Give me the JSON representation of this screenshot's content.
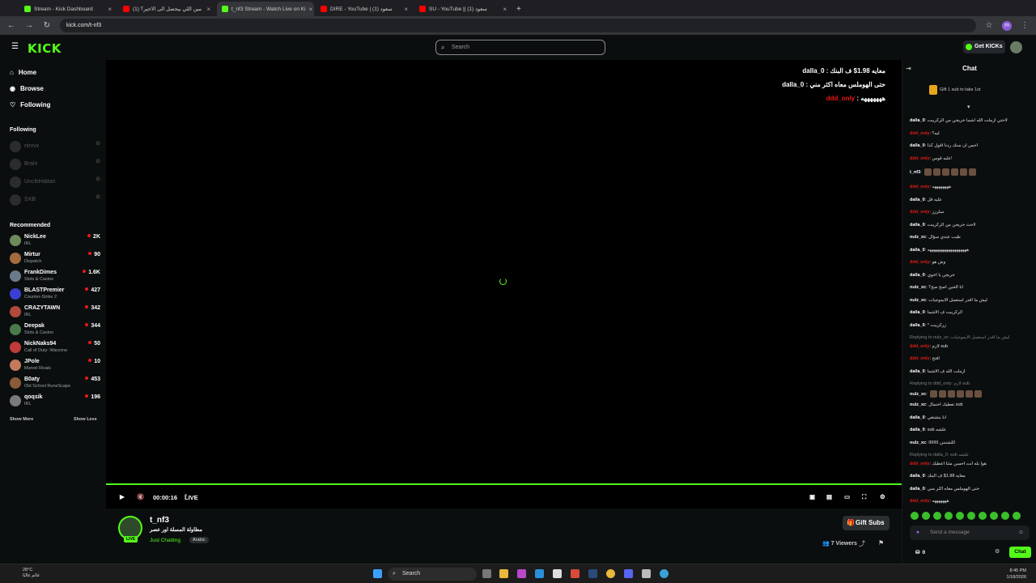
{
  "browser": {
    "tabs": [
      {
        "label": "Stream - Kick Dashboard",
        "color": "#53fc18"
      },
      {
        "label": "(1) مين اللي بيحصل الى الاخير؟",
        "color": "#ff0000"
      },
      {
        "label": "t_nf3 Stream - Watch Live on Ki",
        "color": "#53fc18"
      },
      {
        "label": "DIRE - YouTube | (1) سعود",
        "color": "#ff0000"
      },
      {
        "label": "SU - YouTube || سعود (1)",
        "color": "#ff0000"
      }
    ],
    "url": "kick.com/t-nf3"
  },
  "header": {
    "logo": "KICK",
    "search_placeholder": "Search",
    "get_kicks": "Get KICKs"
  },
  "sidebar": {
    "nav": [
      "Home",
      "Browse",
      "Following"
    ],
    "following_title": "Following",
    "following": [
      "nirvvx",
      "Brain",
      "UncleHattan",
      "SXB"
    ],
    "recommended_title": "Recommended",
    "recommended": [
      {
        "name": "NickLee",
        "category": "IRL",
        "viewers": "2K",
        "color": "#6d8b5a"
      },
      {
        "name": "Mirtur",
        "category": "Dispatch",
        "viewers": "90",
        "color": "#a46b3d"
      },
      {
        "name": "FrankDimes",
        "category": "Slots & Casino",
        "viewers": "1.6K",
        "color": "#6a7a8a"
      },
      {
        "name": "BLASTPremier",
        "category": "Counter-Strike 2",
        "viewers": "427",
        "color": "#3b3fd1"
      },
      {
        "name": "CRAZYTAWN",
        "category": "IRL",
        "viewers": "342",
        "color": "#b04a3a"
      },
      {
        "name": "Deepak",
        "category": "Slots & Casino",
        "viewers": "344",
        "color": "#4a7a4a"
      },
      {
        "name": "NickNaks94",
        "category": "Call of Duty: Warzone",
        "viewers": "50",
        "color": "#c23a3a"
      },
      {
        "name": "JPole",
        "category": "Marvel Rivals",
        "viewers": "10",
        "color": "#c27a5a"
      },
      {
        "name": "B0aty",
        "category": "Old School RuneScape",
        "viewers": "453",
        "color": "#8a5a3a"
      },
      {
        "name": "qoqsik",
        "category": "IRL",
        "viewers": "196",
        "color": "#7a7a7a"
      }
    ],
    "show_more": "Show More",
    "show_less": "Show Less"
  },
  "player": {
    "overlay": [
      {
        "user": "dalla_0",
        "text": "معايه 1.98$ ف البنك",
        "color": "#ffffff"
      },
      {
        "user": "dalla_0",
        "text": "حتى الهوملس معاه اكثر مني",
        "color": "#ffffff"
      },
      {
        "user": "ddd_only",
        "text": "هههههههه",
        "color": "#e91916"
      }
    ],
    "time": "00:00:16",
    "live_label": "LIVE"
  },
  "stream": {
    "name": "t_nf3",
    "title": "مطاولة المسلة اور عصر",
    "category": "Just Chatting",
    "language": "Arabic",
    "gift_subs": "Gift Subs",
    "viewers": "7 Viewers",
    "live_badge": "LIVE"
  },
  "chat": {
    "title": "Chat",
    "gift_banner": "Gift 1 sub to take 1st",
    "messages": [
      {
        "user": "dalla_0",
        "text": "لاحتي ازملت الله اشما خريجي من الركريبت",
        "color": "#ffffff",
        "reply": false
      },
      {
        "user": "ddd_only",
        "text": "ليه؟",
        "color": "#e91916",
        "reply": false
      },
      {
        "user": "dalla_0",
        "text": "احس ان سنك ردنا اقول كذا",
        "color": "#ffffff",
        "reply": false
      },
      {
        "user": "ddd_only",
        "text": "عليه قوس!",
        "color": "#e91916",
        "reply": false
      },
      {
        "user": "t_nf3",
        "text": "",
        "color": "#ffffff",
        "reply": false
      },
      {
        "user": "ddd_only",
        "text": "ههههههههه",
        "color": "#e91916",
        "reply": false
      },
      {
        "user": "dalla_0",
        "text": "عليه قل",
        "color": "#ffffff",
        "reply": false
      },
      {
        "user": "ddd_only",
        "text": "سلرزز",
        "color": "#e91916",
        "reply": false
      },
      {
        "user": "dalla_0",
        "text": "لاحث خريجن من الركريبت",
        "color": "#ffffff",
        "reply": false
      },
      {
        "user": "nulz_xc",
        "text": "طيب عندي سؤال",
        "color": "#ffffff",
        "reply": false
      },
      {
        "user": "dalla_0",
        "text": "هههههههههههههههههههه",
        "color": "#ffffff",
        "reply": false
      },
      {
        "user": "ddd_only",
        "text": "وش هو",
        "color": "#e91916",
        "reply": false
      },
      {
        "user": "dalla_0",
        "text": "خريجن يا اخوي",
        "color": "#ffffff",
        "reply": false
      },
      {
        "user": "nulz_xc",
        "text": "انا الحين اصح صح؟",
        "color": "#ffffff",
        "reply": false
      },
      {
        "user": "nulz_xc",
        "text": "ليش ما اقدر استعمل الايموجيات",
        "color": "#ffffff",
        "reply": false
      },
      {
        "user": "dalla_0",
        "text": "الركريبت ف الاشما",
        "color": "#ffffff",
        "reply": false
      },
      {
        "user": "dalla_0",
        "text": "* زركريبت",
        "color": "#ffffff",
        "reply": false
      },
      {
        "user": "",
        "text": "Replying to nulz_xc: ليش ما اقدر استعمل الايموجيات",
        "color": "#7c8286",
        "reply": true
      },
      {
        "user": "ddd_only",
        "text": "لازم sub",
        "color": "#e91916",
        "reply": false
      },
      {
        "user": "ddd_only",
        "text": "افتح",
        "color": "#e91916",
        "reply": false
      },
      {
        "user": "dalla_0",
        "text": "ازملت الله ف الاشما",
        "color": "#ffffff",
        "reply": false
      },
      {
        "user": "",
        "text": "Replying to ddd_only: لازم sub",
        "color": "#7c8286",
        "reply": true
      },
      {
        "user": "nulz_xc",
        "text": "",
        "color": "#ffffff",
        "reply": false
      },
      {
        "user": "nulz_xc",
        "text": "تعطيك احتمال sub",
        "color": "#ffffff",
        "reply": false
      },
      {
        "user": "dalla_0",
        "text": "انا بتشتغي",
        "color": "#ffffff",
        "reply": false
      },
      {
        "user": "dalla_0",
        "text": "sub علشه",
        "color": "#ffffff",
        "reply": false
      },
      {
        "user": "nulz_xc",
        "text": "IIIIIIII اللشنننن",
        "color": "#ffffff",
        "reply": false
      },
      {
        "user": "",
        "text": "Replying to dalla_0: sub علشه",
        "color": "#7c8286",
        "reply": true
      },
      {
        "user": "ddd_only",
        "text": "هوا بله انت احسن مثنا اعطيك",
        "color": "#e91916",
        "reply": false
      },
      {
        "user": "dalla_0",
        "text": "معايه 1.98$ ف البنك",
        "color": "#ffffff",
        "reply": false
      },
      {
        "user": "dalla_0",
        "text": "حتى الهوملس معاه اكثر مني",
        "color": "#ffffff",
        "reply": false
      },
      {
        "user": "ddd_only",
        "text": "هههههههه",
        "color": "#e91916",
        "reply": false
      }
    ],
    "input_placeholder": "Send a message",
    "send_label": "Chat",
    "points": "0"
  },
  "taskbar": {
    "search": "Search",
    "weather_temp": "28°C",
    "weather_desc": "غائم غالبًا",
    "time": "8:45 PM",
    "date": "1/18/2026"
  }
}
